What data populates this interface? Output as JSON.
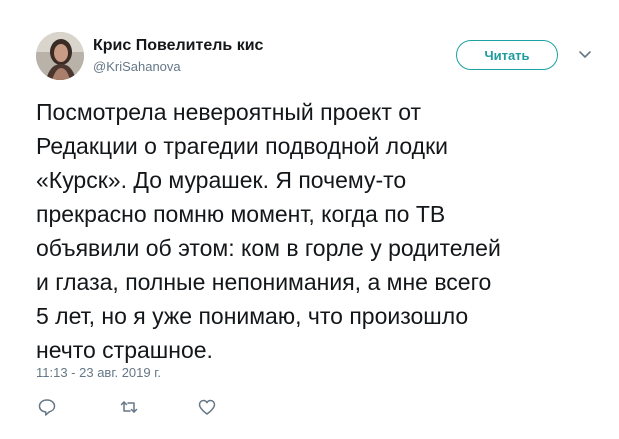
{
  "author": {
    "display_name": "Крис Повелитель кис",
    "handle": "@KriSahanova",
    "avatar_icon": "profile-photo"
  },
  "follow_button": {
    "label": "Читать",
    "color": "#1da1a1"
  },
  "menu_icon": "chevron-down-icon",
  "tweet": {
    "text_lines": [
      "Посмотрела невероятный проект от",
      "Редакции о трагедии подводной лодки",
      "«Курск». До мурашек. Я почему-то",
      "прекрасно помню момент, когда по ТВ",
      "объявили об этом: ком в горле у родителей",
      "и глаза, полные непонимания, а мне всего",
      "5 лет, но я уже понимаю, что произошло",
      "нечто страшное."
    ],
    "timestamp": "11:13 - 23 авг. 2019 г."
  },
  "actions": [
    {
      "name": "reply",
      "icon": "reply-icon"
    },
    {
      "name": "retweet",
      "icon": "retweet-icon"
    },
    {
      "name": "like",
      "icon": "heart-icon"
    }
  ],
  "colors": {
    "text": "#14171a",
    "secondary": "#657786",
    "accent": "#1da1a1"
  }
}
